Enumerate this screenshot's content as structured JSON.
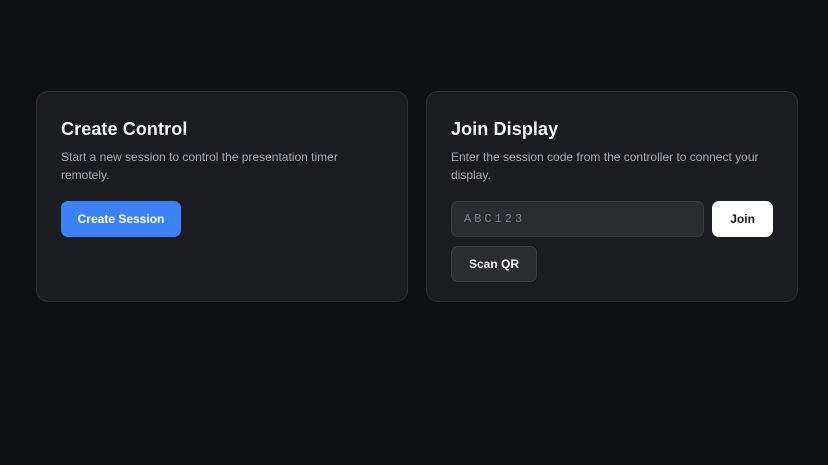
{
  "create_card": {
    "title": "Create Control",
    "description": "Start a new session to control the presentation timer remotely.",
    "create_button_label": "Create Session"
  },
  "join_card": {
    "title": "Join Display",
    "description": "Enter the session code from the controller to connect your display.",
    "code_input_value": "",
    "code_input_placeholder": "ABC123",
    "join_button_label": "Join",
    "scan_qr_button_label": "Scan QR"
  },
  "colors": {
    "background": "#0e0f13",
    "card": "#1b1c20",
    "primary": "#3b82f6"
  }
}
